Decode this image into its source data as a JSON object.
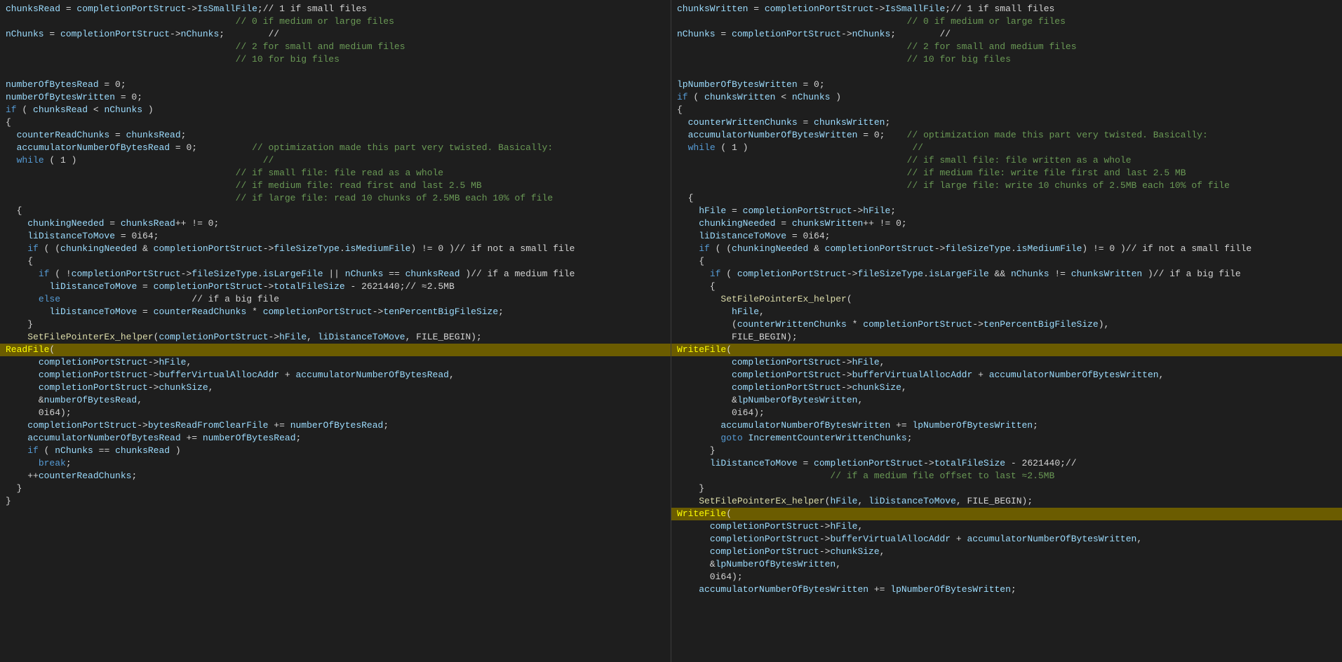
{
  "left_pane": {
    "lines": []
  },
  "right_pane": {
    "lines": []
  }
}
